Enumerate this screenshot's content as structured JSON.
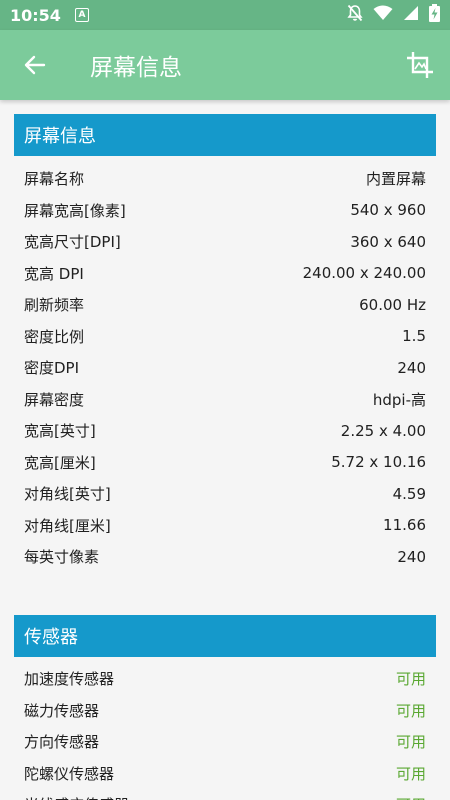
{
  "status_bar": {
    "time": "10:54",
    "badge": "A"
  },
  "app_bar": {
    "title": "屏幕信息"
  },
  "screen_section": {
    "title": "屏幕信息",
    "rows": [
      {
        "label": "屏幕名称",
        "value": "内置屏幕"
      },
      {
        "label": "屏幕宽高[像素]",
        "value": "540 x 960"
      },
      {
        "label": "宽高尺寸[DPI]",
        "value": "360 x 640"
      },
      {
        "label": "宽高 DPI",
        "value": "240.00 x 240.00"
      },
      {
        "label": "刷新频率",
        "value": "60.00 Hz"
      },
      {
        "label": "密度比例",
        "value": "1.5"
      },
      {
        "label": "密度DPI",
        "value": "240"
      },
      {
        "label": "屏幕密度",
        "value": "hdpi-高"
      },
      {
        "label": "宽高[英寸]",
        "value": "2.25 x 4.00"
      },
      {
        "label": "宽高[厘米]",
        "value": "5.72 x 10.16"
      },
      {
        "label": "对角线[英寸]",
        "value": "4.59"
      },
      {
        "label": "对角线[厘米]",
        "value": "11.66"
      },
      {
        "label": "每英寸像素",
        "value": "240"
      }
    ]
  },
  "sensor_section": {
    "title": "传感器",
    "rows": [
      {
        "label": "加速度传感器",
        "value": "可用"
      },
      {
        "label": "磁力传感器",
        "value": "可用"
      },
      {
        "label": "方向传感器",
        "value": "可用"
      },
      {
        "label": "陀螺仪传感器",
        "value": "可用"
      },
      {
        "label": "光线感应传感器",
        "value": "可用"
      }
    ]
  },
  "colors": {
    "status_bar": "#66b586",
    "app_bar": "#7ccb9b",
    "section_header": "#1599cb",
    "available": "#5aa832"
  }
}
